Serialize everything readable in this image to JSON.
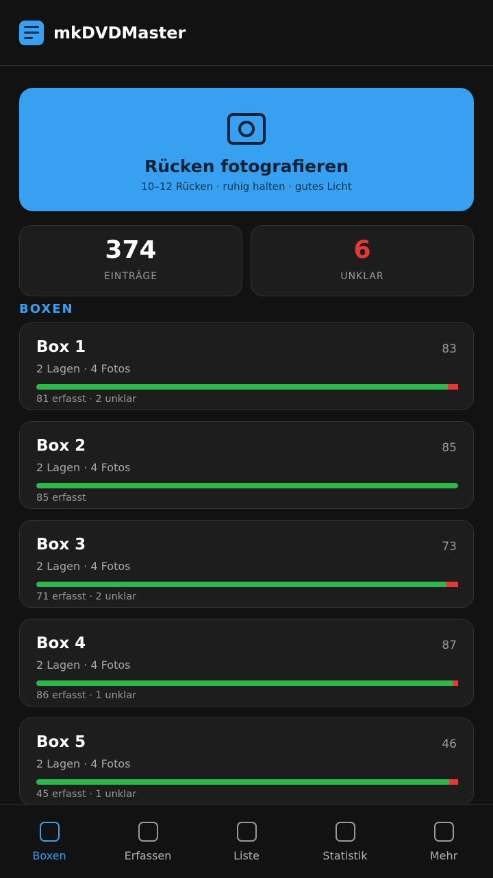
{
  "app": {
    "title": "mkDVDMaster"
  },
  "colors": {
    "accent": "#37a0f0",
    "background": "#121212",
    "card": "#1d1d1d",
    "ok_green": "#2fb84a",
    "unclear_red": "#e53935"
  },
  "photo_action": {
    "icon": "camera-icon",
    "title": "Rücken fotografieren",
    "subtitle": "10–12 Rücken · ruhig halten · gutes Licht"
  },
  "stats": {
    "entries_value": "374",
    "entries_label": "EINTRÄGE",
    "unclear_value": "6",
    "unclear_label": "UNKLAR"
  },
  "section_title": "BOXEN",
  "boxes": [
    {
      "name": "Box 1",
      "count": "83",
      "meta": "2 Lagen · 4 Fotos",
      "status": "81 erfasst · 2 unklar",
      "captured": 81,
      "unclear": 2
    },
    {
      "name": "Box 2",
      "count": "85",
      "meta": "2 Lagen · 4 Fotos",
      "status": "85 erfasst",
      "captured": 85,
      "unclear": 0
    },
    {
      "name": "Box 3",
      "count": "73",
      "meta": "2 Lagen · 4 Fotos",
      "status": "71 erfasst · 2 unklar",
      "captured": 71,
      "unclear": 2
    },
    {
      "name": "Box 4",
      "count": "87",
      "meta": "2 Lagen · 4 Fotos",
      "status": "86 erfasst · 1 unklar",
      "captured": 86,
      "unclear": 1
    },
    {
      "name": "Box 5",
      "count": "46",
      "meta": "2 Lagen · 4 Fotos",
      "status": "45 erfasst · 1 unklar",
      "captured": 45,
      "unclear": 1
    }
  ],
  "nav": [
    {
      "label": "Boxen",
      "active": true
    },
    {
      "label": "Erfassen",
      "active": false
    },
    {
      "label": "Liste",
      "active": false
    },
    {
      "label": "Statistik",
      "active": false
    },
    {
      "label": "Mehr",
      "active": false
    }
  ]
}
